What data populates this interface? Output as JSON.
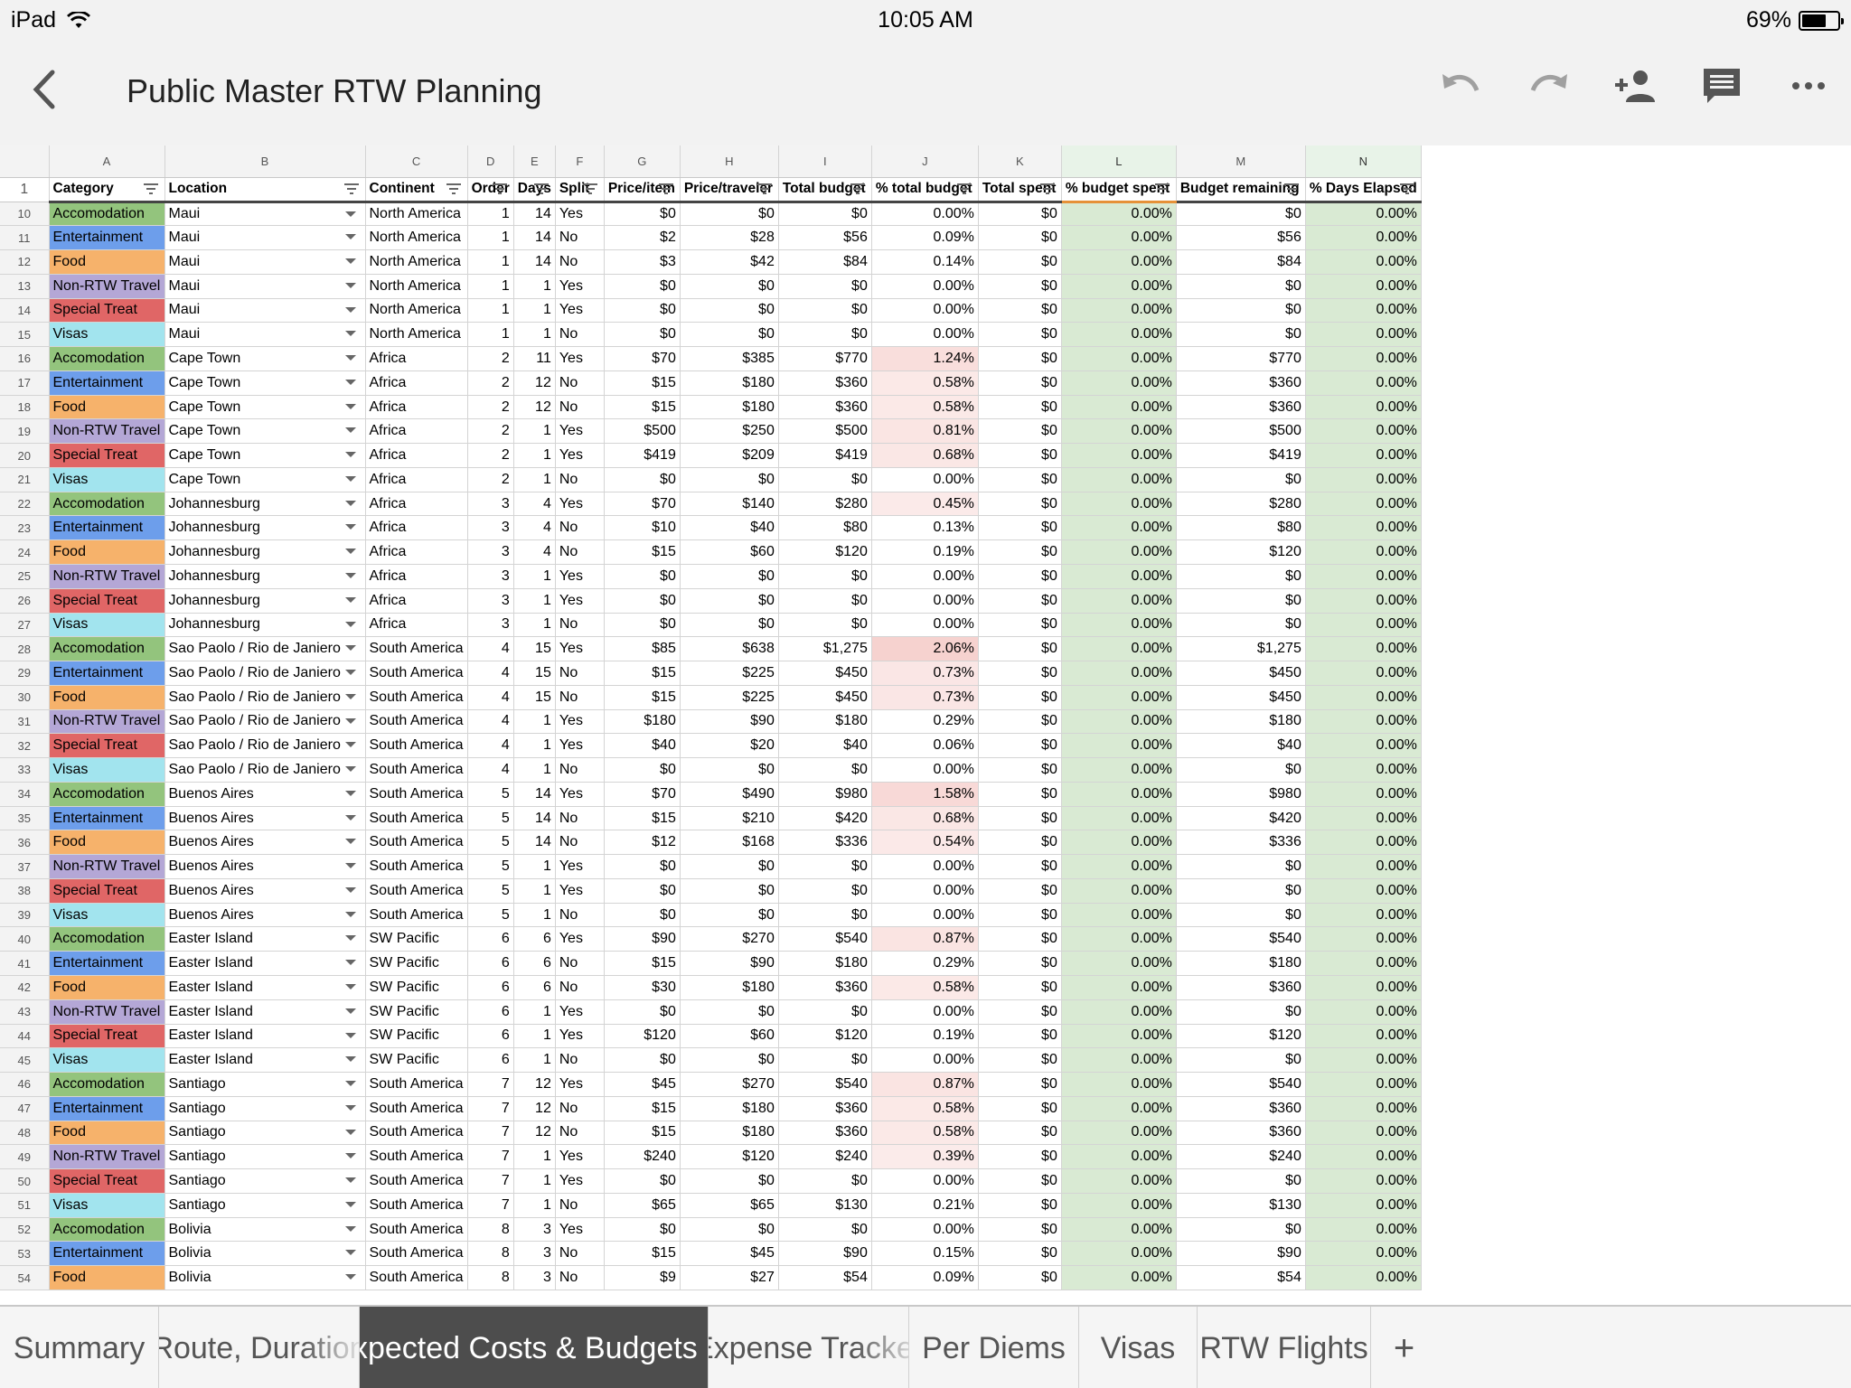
{
  "status": {
    "device": "iPad",
    "time": "10:05 AM",
    "battery": "69%",
    "battery_level": 0.69
  },
  "toolbar": {
    "title": "Public Master RTW Planning",
    "back_icon": "chevron-left-icon",
    "actions": [
      "undo-icon",
      "redo-icon",
      "add-person-icon",
      "comment-icon",
      "more-icon"
    ]
  },
  "colors": {
    "Accomodation": "#93c47d",
    "Entertainment": "#6d9eeb",
    "Food": "#f6b26b",
    "Non-RTW Travel": "#b4a7d6",
    "Special Treat": "#e06666",
    "Visas": "#a2e4ee",
    "green_col": "#d9ead3",
    "pct_tint": "#fbe4e2",
    "active_tab": "#4d4d4d"
  },
  "sheet": {
    "col_letters": [
      "A",
      "B",
      "C",
      "D",
      "E",
      "F",
      "G",
      "H",
      "I",
      "J",
      "K",
      "L",
      "M",
      "N"
    ],
    "header_row_num": "1",
    "headers": [
      "Category",
      "Location",
      "Continent",
      "Order",
      "Days",
      "Split",
      "Price/item",
      "Price/traveler",
      "Total budget",
      "% total budget",
      "Total spent",
      "% budget spent",
      "Budget remaining",
      "% Days Elapsed"
    ],
    "rows": [
      [
        "10",
        "Accomodation",
        "Maui",
        "North America",
        "1",
        "14",
        "Yes",
        "$0",
        "$0",
        "$0",
        "0.00%",
        "$0",
        "0.00%",
        "$0",
        "0.00%"
      ],
      [
        "11",
        "Entertainment",
        "Maui",
        "North America",
        "1",
        "14",
        "No",
        "$2",
        "$28",
        "$56",
        "0.09%",
        "$0",
        "0.00%",
        "$56",
        "0.00%"
      ],
      [
        "12",
        "Food",
        "Maui",
        "North America",
        "1",
        "14",
        "No",
        "$3",
        "$42",
        "$84",
        "0.14%",
        "$0",
        "0.00%",
        "$84",
        "0.00%"
      ],
      [
        "13",
        "Non-RTW Travel",
        "Maui",
        "North America",
        "1",
        "1",
        "Yes",
        "$0",
        "$0",
        "$0",
        "0.00%",
        "$0",
        "0.00%",
        "$0",
        "0.00%"
      ],
      [
        "14",
        "Special Treat",
        "Maui",
        "North America",
        "1",
        "1",
        "Yes",
        "$0",
        "$0",
        "$0",
        "0.00%",
        "$0",
        "0.00%",
        "$0",
        "0.00%"
      ],
      [
        "15",
        "Visas",
        "Maui",
        "North America",
        "1",
        "1",
        "No",
        "$0",
        "$0",
        "$0",
        "0.00%",
        "$0",
        "0.00%",
        "$0",
        "0.00%"
      ],
      [
        "16",
        "Accomodation",
        "Cape Town",
        "Africa",
        "2",
        "11",
        "Yes",
        "$70",
        "$385",
        "$770",
        "1.24%",
        "$0",
        "0.00%",
        "$770",
        "0.00%"
      ],
      [
        "17",
        "Entertainment",
        "Cape Town",
        "Africa",
        "2",
        "12",
        "No",
        "$15",
        "$180",
        "$360",
        "0.58%",
        "$0",
        "0.00%",
        "$360",
        "0.00%"
      ],
      [
        "18",
        "Food",
        "Cape Town",
        "Africa",
        "2",
        "12",
        "No",
        "$15",
        "$180",
        "$360",
        "0.58%",
        "$0",
        "0.00%",
        "$360",
        "0.00%"
      ],
      [
        "19",
        "Non-RTW Travel",
        "Cape Town",
        "Africa",
        "2",
        "1",
        "Yes",
        "$500",
        "$250",
        "$500",
        "0.81%",
        "$0",
        "0.00%",
        "$500",
        "0.00%"
      ],
      [
        "20",
        "Special Treat",
        "Cape Town",
        "Africa",
        "2",
        "1",
        "Yes",
        "$419",
        "$209",
        "$419",
        "0.68%",
        "$0",
        "0.00%",
        "$419",
        "0.00%"
      ],
      [
        "21",
        "Visas",
        "Cape Town",
        "Africa",
        "2",
        "1",
        "No",
        "$0",
        "$0",
        "$0",
        "0.00%",
        "$0",
        "0.00%",
        "$0",
        "0.00%"
      ],
      [
        "22",
        "Accomodation",
        "Johannesburg",
        "Africa",
        "3",
        "4",
        "Yes",
        "$70",
        "$140",
        "$280",
        "0.45%",
        "$0",
        "0.00%",
        "$280",
        "0.00%"
      ],
      [
        "23",
        "Entertainment",
        "Johannesburg",
        "Africa",
        "3",
        "4",
        "No",
        "$10",
        "$40",
        "$80",
        "0.13%",
        "$0",
        "0.00%",
        "$80",
        "0.00%"
      ],
      [
        "24",
        "Food",
        "Johannesburg",
        "Africa",
        "3",
        "4",
        "No",
        "$15",
        "$60",
        "$120",
        "0.19%",
        "$0",
        "0.00%",
        "$120",
        "0.00%"
      ],
      [
        "25",
        "Non-RTW Travel",
        "Johannesburg",
        "Africa",
        "3",
        "1",
        "Yes",
        "$0",
        "$0",
        "$0",
        "0.00%",
        "$0",
        "0.00%",
        "$0",
        "0.00%"
      ],
      [
        "26",
        "Special Treat",
        "Johannesburg",
        "Africa",
        "3",
        "1",
        "Yes",
        "$0",
        "$0",
        "$0",
        "0.00%",
        "$0",
        "0.00%",
        "$0",
        "0.00%"
      ],
      [
        "27",
        "Visas",
        "Johannesburg",
        "Africa",
        "3",
        "1",
        "No",
        "$0",
        "$0",
        "$0",
        "0.00%",
        "$0",
        "0.00%",
        "$0",
        "0.00%"
      ],
      [
        "28",
        "Accomodation",
        "Sao Paolo / Rio de Janiero",
        "South America",
        "4",
        "15",
        "Yes",
        "$85",
        "$638",
        "$1,275",
        "2.06%",
        "$0",
        "0.00%",
        "$1,275",
        "0.00%"
      ],
      [
        "29",
        "Entertainment",
        "Sao Paolo / Rio de Janiero",
        "South America",
        "4",
        "15",
        "No",
        "$15",
        "$225",
        "$450",
        "0.73%",
        "$0",
        "0.00%",
        "$450",
        "0.00%"
      ],
      [
        "30",
        "Food",
        "Sao Paolo / Rio de Janiero",
        "South America",
        "4",
        "15",
        "No",
        "$15",
        "$225",
        "$450",
        "0.73%",
        "$0",
        "0.00%",
        "$450",
        "0.00%"
      ],
      [
        "31",
        "Non-RTW Travel",
        "Sao Paolo / Rio de Janiero",
        "South America",
        "4",
        "1",
        "Yes",
        "$180",
        "$90",
        "$180",
        "0.29%",
        "$0",
        "0.00%",
        "$180",
        "0.00%"
      ],
      [
        "32",
        "Special Treat",
        "Sao Paolo / Rio de Janiero",
        "South America",
        "4",
        "1",
        "Yes",
        "$40",
        "$20",
        "$40",
        "0.06%",
        "$0",
        "0.00%",
        "$40",
        "0.00%"
      ],
      [
        "33",
        "Visas",
        "Sao Paolo / Rio de Janiero",
        "South America",
        "4",
        "1",
        "No",
        "$0",
        "$0",
        "$0",
        "0.00%",
        "$0",
        "0.00%",
        "$0",
        "0.00%"
      ],
      [
        "34",
        "Accomodation",
        "Buenos Aires",
        "South America",
        "5",
        "14",
        "Yes",
        "$70",
        "$490",
        "$980",
        "1.58%",
        "$0",
        "0.00%",
        "$980",
        "0.00%"
      ],
      [
        "35",
        "Entertainment",
        "Buenos Aires",
        "South America",
        "5",
        "14",
        "No",
        "$15",
        "$210",
        "$420",
        "0.68%",
        "$0",
        "0.00%",
        "$420",
        "0.00%"
      ],
      [
        "36",
        "Food",
        "Buenos Aires",
        "South America",
        "5",
        "14",
        "No",
        "$12",
        "$168",
        "$336",
        "0.54%",
        "$0",
        "0.00%",
        "$336",
        "0.00%"
      ],
      [
        "37",
        "Non-RTW Travel",
        "Buenos Aires",
        "South America",
        "5",
        "1",
        "Yes",
        "$0",
        "$0",
        "$0",
        "0.00%",
        "$0",
        "0.00%",
        "$0",
        "0.00%"
      ],
      [
        "38",
        "Special Treat",
        "Buenos Aires",
        "South America",
        "5",
        "1",
        "Yes",
        "$0",
        "$0",
        "$0",
        "0.00%",
        "$0",
        "0.00%",
        "$0",
        "0.00%"
      ],
      [
        "39",
        "Visas",
        "Buenos Aires",
        "South America",
        "5",
        "1",
        "No",
        "$0",
        "$0",
        "$0",
        "0.00%",
        "$0",
        "0.00%",
        "$0",
        "0.00%"
      ],
      [
        "40",
        "Accomodation",
        "Easter Island",
        "SW Pacific",
        "6",
        "6",
        "Yes",
        "$90",
        "$270",
        "$540",
        "0.87%",
        "$0",
        "0.00%",
        "$540",
        "0.00%"
      ],
      [
        "41",
        "Entertainment",
        "Easter Island",
        "SW Pacific",
        "6",
        "6",
        "No",
        "$15",
        "$90",
        "$180",
        "0.29%",
        "$0",
        "0.00%",
        "$180",
        "0.00%"
      ],
      [
        "42",
        "Food",
        "Easter Island",
        "SW Pacific",
        "6",
        "6",
        "No",
        "$30",
        "$180",
        "$360",
        "0.58%",
        "$0",
        "0.00%",
        "$360",
        "0.00%"
      ],
      [
        "43",
        "Non-RTW Travel",
        "Easter Island",
        "SW Pacific",
        "6",
        "1",
        "Yes",
        "$0",
        "$0",
        "$0",
        "0.00%",
        "$0",
        "0.00%",
        "$0",
        "0.00%"
      ],
      [
        "44",
        "Special Treat",
        "Easter Island",
        "SW Pacific",
        "6",
        "1",
        "Yes",
        "$120",
        "$60",
        "$120",
        "0.19%",
        "$0",
        "0.00%",
        "$120",
        "0.00%"
      ],
      [
        "45",
        "Visas",
        "Easter Island",
        "SW Pacific",
        "6",
        "1",
        "No",
        "$0",
        "$0",
        "$0",
        "0.00%",
        "$0",
        "0.00%",
        "$0",
        "0.00%"
      ],
      [
        "46",
        "Accomodation",
        "Santiago",
        "South America",
        "7",
        "12",
        "Yes",
        "$45",
        "$270",
        "$540",
        "0.87%",
        "$0",
        "0.00%",
        "$540",
        "0.00%"
      ],
      [
        "47",
        "Entertainment",
        "Santiago",
        "South America",
        "7",
        "12",
        "No",
        "$15",
        "$180",
        "$360",
        "0.58%",
        "$0",
        "0.00%",
        "$360",
        "0.00%"
      ],
      [
        "48",
        "Food",
        "Santiago",
        "South America",
        "7",
        "12",
        "No",
        "$15",
        "$180",
        "$360",
        "0.58%",
        "$0",
        "0.00%",
        "$360",
        "0.00%"
      ],
      [
        "49",
        "Non-RTW Travel",
        "Santiago",
        "South America",
        "7",
        "1",
        "Yes",
        "$240",
        "$120",
        "$240",
        "0.39%",
        "$0",
        "0.00%",
        "$240",
        "0.00%"
      ],
      [
        "50",
        "Special Treat",
        "Santiago",
        "South America",
        "7",
        "1",
        "Yes",
        "$0",
        "$0",
        "$0",
        "0.00%",
        "$0",
        "0.00%",
        "$0",
        "0.00%"
      ],
      [
        "51",
        "Visas",
        "Santiago",
        "South America",
        "7",
        "1",
        "No",
        "$65",
        "$65",
        "$130",
        "0.21%",
        "$0",
        "0.00%",
        "$130",
        "0.00%"
      ],
      [
        "52",
        "Accomodation",
        "Bolivia",
        "South America",
        "8",
        "3",
        "Yes",
        "$0",
        "$0",
        "$0",
        "0.00%",
        "$0",
        "0.00%",
        "$0",
        "0.00%"
      ],
      [
        "53",
        "Entertainment",
        "Bolivia",
        "South America",
        "8",
        "3",
        "No",
        "$15",
        "$45",
        "$90",
        "0.15%",
        "$0",
        "0.00%",
        "$90",
        "0.00%"
      ],
      [
        "54",
        "Food",
        "Bolivia",
        "South America",
        "8",
        "3",
        "No",
        "$9",
        "$27",
        "$54",
        "0.09%",
        "$0",
        "0.00%",
        "$54",
        "0.00%"
      ]
    ]
  },
  "tabs": [
    {
      "label": "Summary",
      "active": false
    },
    {
      "label": "Route, Duration",
      "active": false
    },
    {
      "label": "Expected Costs & Budgets",
      "active": true
    },
    {
      "label": "Expense Tracker",
      "active": false
    },
    {
      "label": "Per Diems",
      "active": false
    },
    {
      "label": "Visas",
      "active": false
    },
    {
      "label": "RTW Flights",
      "active": false
    }
  ],
  "add_tab": "+"
}
